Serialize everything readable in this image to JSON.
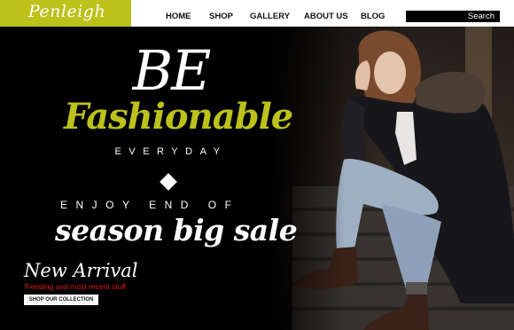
{
  "brand": {
    "logo": "Penleigh",
    "accent": "#bcc21a"
  },
  "nav": {
    "items": [
      {
        "label": "HOME"
      },
      {
        "label": "SHOP"
      },
      {
        "label": "GALLERY"
      },
      {
        "label": "ABOUT US"
      },
      {
        "label": "BLOG"
      }
    ]
  },
  "search": {
    "label": "Search"
  },
  "hero": {
    "headline_1": "BE",
    "headline_2": "Fashionable",
    "headline_3": "EVERYDAY",
    "tagline": "ENJOY END OF",
    "sale": "season big sale",
    "sub_headline": "New Arrival",
    "sub_text": "Trending and most recent stuff",
    "cta_label": "SHOP OUR COLLECTION",
    "sub_text_color": "#e0161a"
  }
}
